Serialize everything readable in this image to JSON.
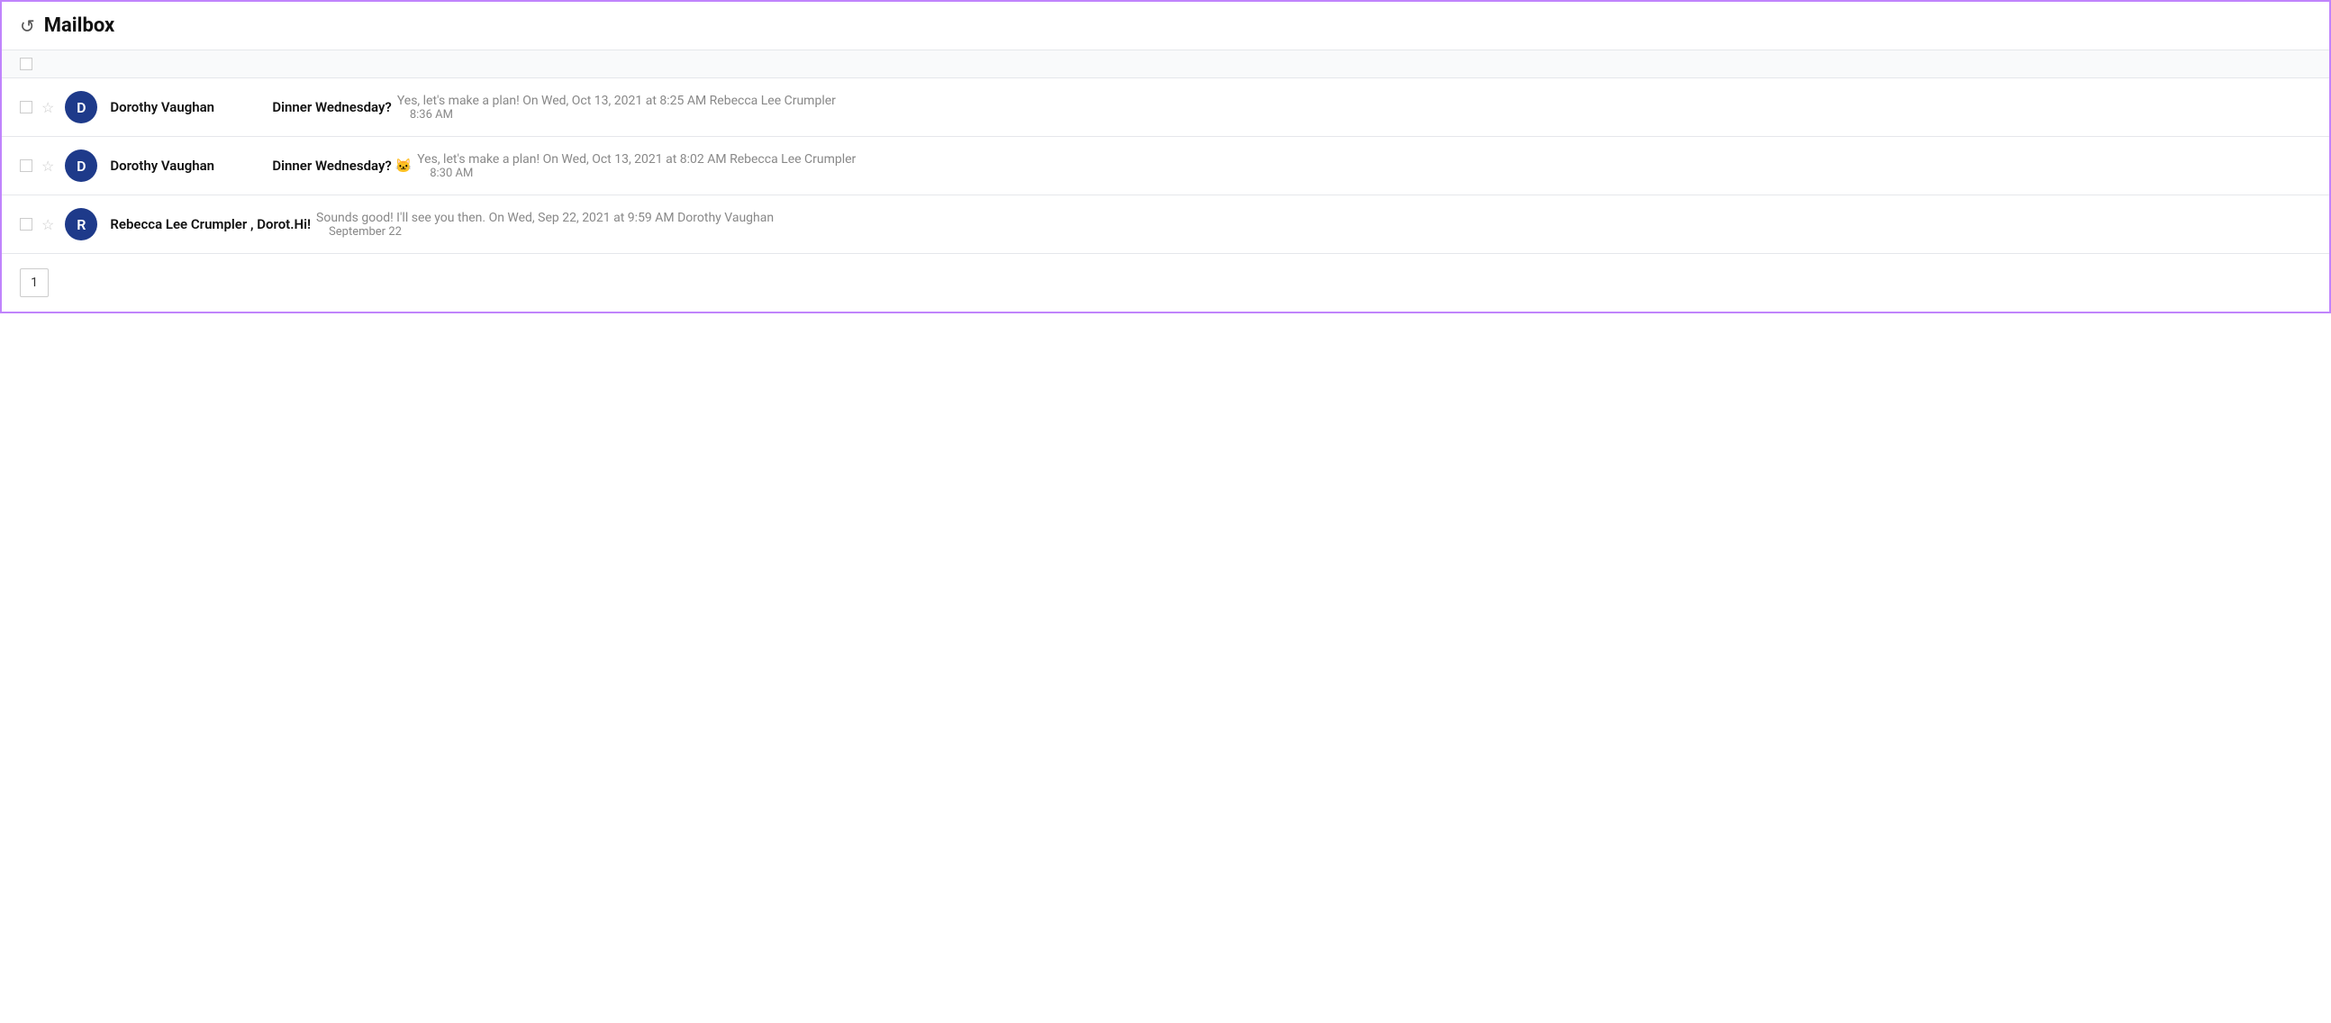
{
  "header": {
    "title": "Mailbox",
    "icon": "↺"
  },
  "emails": [
    {
      "id": 1,
      "avatar_letter": "D",
      "avatar_color": "#1e3a8a",
      "sender": "Dorothy Vaughan",
      "subject": "Dinner Wednesday?",
      "preview": "Yes, let's make a plan! On Wed, Oct 13, 2021 at 8:25 AM Rebecca Lee Crumpler <healthcare.demo@nyla...",
      "timestamp": "8:36 AM",
      "starred": false,
      "unread": true
    },
    {
      "id": 2,
      "avatar_letter": "D",
      "avatar_color": "#1e3a8a",
      "sender": "Dorothy Vaughan",
      "subject": "Dinner Wednesday? 🐱",
      "preview": "Yes, let's make a plan! On Wed, Oct 13, 2021 at 8:02 AM Rebecca Lee Crumpler <healthcare.demo@n...",
      "timestamp": "8:30 AM",
      "starred": false,
      "unread": true
    },
    {
      "id": 3,
      "avatar_letter": "R",
      "avatar_color": "#1e3a8a",
      "sender": "Rebecca Lee Crumpler , Dorot.",
      "subject": "Hi!",
      "preview": "Sounds good! I'll see you then. On Wed, Sep 22, 2021 at 9:59 AM Dorothy Vaughan <demo@nylas.com...",
      "timestamp": "September 22",
      "starred": false,
      "unread": false
    }
  ],
  "pagination": {
    "current_page": 1,
    "page_label": "1"
  },
  "toolbar": {
    "select_all_label": ""
  }
}
